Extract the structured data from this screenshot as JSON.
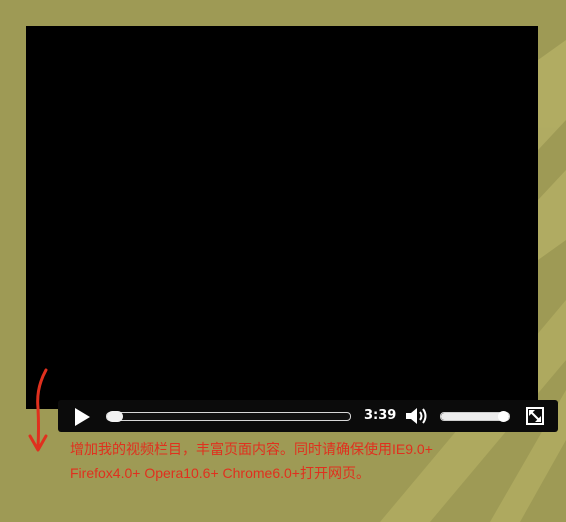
{
  "colors": {
    "background": "#9e9a55",
    "video": "#000000",
    "note_text": "#e0301e",
    "annotation_arrow": "#e0301e"
  },
  "player": {
    "play_icon": "play-icon",
    "current_time": "3:39",
    "progress_fraction": 0.03,
    "volume_icon": "volume-icon",
    "volume_fraction": 0.95,
    "fullscreen_icon": "fullscreen-icon"
  },
  "note": {
    "line1": "增加我的视频栏目，丰富页面内容。同时请确保使用IE9.0+",
    "line2": "Firefox4.0+ Opera10.6+ Chrome6.0+打开网页。"
  }
}
